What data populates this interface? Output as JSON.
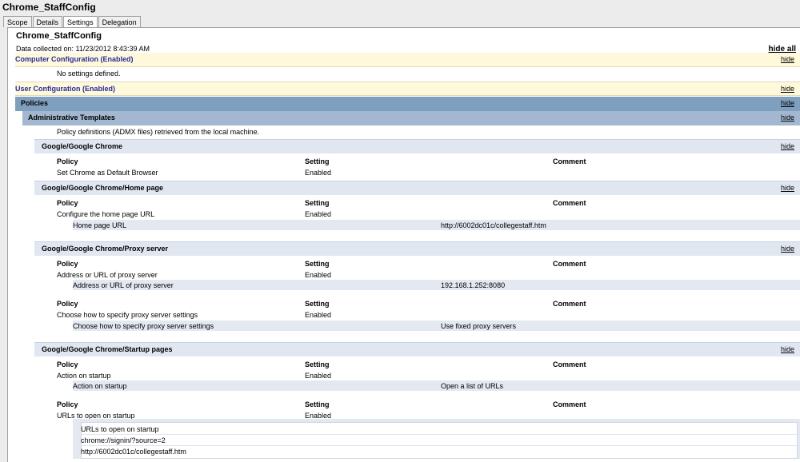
{
  "window": {
    "title": "Chrome_StaffConfig"
  },
  "tabs": [
    {
      "label": "Scope"
    },
    {
      "label": "Details"
    },
    {
      "label": "Settings",
      "active": true
    },
    {
      "label": "Delegation"
    }
  ],
  "report": {
    "title": "Chrome_StaffConfig",
    "collected": "Data collected on: 11/23/2012 8:43:39 AM",
    "hide_all": "hide all"
  },
  "hide_label": "hide",
  "computer": {
    "label": "Computer Configuration (Enabled)",
    "no_settings": "No settings defined."
  },
  "user": {
    "label": "User Configuration (Enabled)"
  },
  "policies": {
    "label": "Policies"
  },
  "admin": {
    "label": "Administrative Templates",
    "note": "Policy definitions (ADMX files) retrieved from the local machine."
  },
  "headers": {
    "policy": "Policy",
    "setting": "Setting",
    "comment": "Comment"
  },
  "chrome": {
    "label": "Google/Google Chrome",
    "policy": "Set Chrome as Default Browser",
    "setting": "Enabled"
  },
  "homepage": {
    "label": "Google/Google Chrome/Home page",
    "policy": "Configure the home page URL",
    "setting": "Enabled",
    "sub_label": "Home page URL",
    "sub_value": "http://6002dc01c/collegestaff.htm"
  },
  "proxy": {
    "label": "Google/Google Chrome/Proxy server",
    "p1": {
      "policy": "Address or URL of proxy server",
      "setting": "Enabled",
      "sub_label": "Address or URL of proxy server",
      "sub_value": "192.168.1.252:8080"
    },
    "p2": {
      "policy": "Choose how to specify proxy server settings",
      "setting": "Enabled",
      "sub_label": "Choose how to specify proxy server settings",
      "sub_value": "Use fixed proxy servers"
    }
  },
  "startup": {
    "label": "Google/Google Chrome/Startup pages",
    "p1": {
      "policy": "Action on startup",
      "setting": "Enabled",
      "sub_label": "Action on startup",
      "sub_value": "Open a list of URLs"
    },
    "p2": {
      "policy": "URLs to open on startup",
      "setting": "Enabled",
      "box_title": "URLs to open on startup",
      "urls": [
        "chrome://signin/?source=2",
        "http://6002dc01c/collegestaff.htm"
      ]
    }
  }
}
